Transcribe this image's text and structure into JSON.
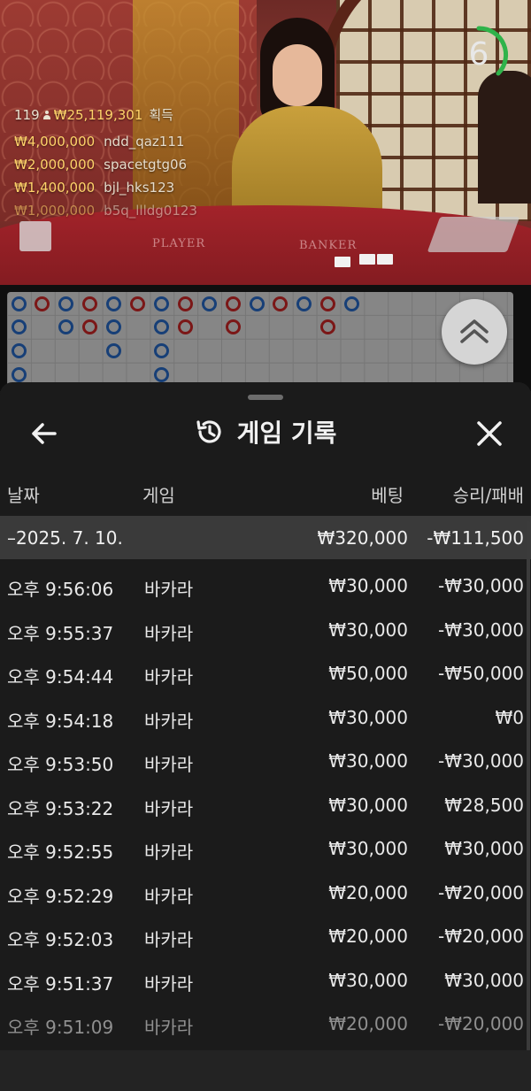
{
  "video": {
    "table_left": "PLAYER",
    "table_right": "BANKER",
    "timer": "6",
    "winners": {
      "count": "119",
      "total": "₩25,119,301",
      "suffix": "획득",
      "list": [
        {
          "amount": "₩4,000,000",
          "name": "ndd_qaz111"
        },
        {
          "amount": "₩2,000,000",
          "name": "spacetgtg06"
        },
        {
          "amount": "₩1,400,000",
          "name": "bjl_hks123"
        },
        {
          "amount": "₩1,000,000",
          "name": "b5q_llldg0123"
        }
      ]
    }
  },
  "colors": {
    "banker": "#e02b2b",
    "player": "#2b74d9",
    "tie": "#1f9a3a"
  },
  "roadmap": {
    "columns": [
      [
        "B",
        "B",
        "B",
        "B"
      ],
      [
        "R"
      ],
      [
        "B",
        "B"
      ],
      [
        "R",
        "R"
      ],
      [
        "B",
        "B",
        "B"
      ],
      [
        "R"
      ],
      [
        "B",
        "B",
        "B",
        "B"
      ],
      [
        "R",
        "R"
      ],
      [
        "B"
      ],
      [
        "R",
        "R"
      ],
      [
        "B"
      ],
      [
        "R"
      ],
      [
        "B"
      ],
      [
        "R",
        "R"
      ],
      [
        "B"
      ]
    ]
  },
  "sheet": {
    "title": "게임 기록",
    "back_icon": "back-arrow-icon",
    "history_icon": "history-icon",
    "close_icon": "close-icon",
    "columns": {
      "date": "날짜",
      "game": "게임",
      "bet": "베팅",
      "result": "승리/패배"
    },
    "summary": {
      "date": "–2025. 7. 10.",
      "bet": "₩320,000",
      "result": "-₩111,500"
    },
    "rows": [
      {
        "time": "오후 9:56:06",
        "game": "바카라",
        "bet": "₩30,000",
        "result": "-₩30,000"
      },
      {
        "time": "오후 9:55:37",
        "game": "바카라",
        "bet": "₩30,000",
        "result": "-₩30,000"
      },
      {
        "time": "오후 9:54:44",
        "game": "바카라",
        "bet": "₩50,000",
        "result": "-₩50,000"
      },
      {
        "time": "오후 9:54:18",
        "game": "바카라",
        "bet": "₩30,000",
        "result": "₩0"
      },
      {
        "time": "오후 9:53:50",
        "game": "바카라",
        "bet": "₩30,000",
        "result": "-₩30,000"
      },
      {
        "time": "오후 9:53:22",
        "game": "바카라",
        "bet": "₩30,000",
        "result": "₩28,500"
      },
      {
        "time": "오후 9:52:55",
        "game": "바카라",
        "bet": "₩30,000",
        "result": "₩30,000"
      },
      {
        "time": "오후 9:52:29",
        "game": "바카라",
        "bet": "₩20,000",
        "result": "-₩20,000"
      },
      {
        "time": "오후 9:52:03",
        "game": "바카라",
        "bet": "₩20,000",
        "result": "-₩20,000"
      },
      {
        "time": "오후 9:51:37",
        "game": "바카라",
        "bet": "₩30,000",
        "result": "₩30,000"
      },
      {
        "time": "오후 9:51:09",
        "game": "바카라",
        "bet": "₩20,000",
        "result": "-₩20,000"
      }
    ]
  }
}
